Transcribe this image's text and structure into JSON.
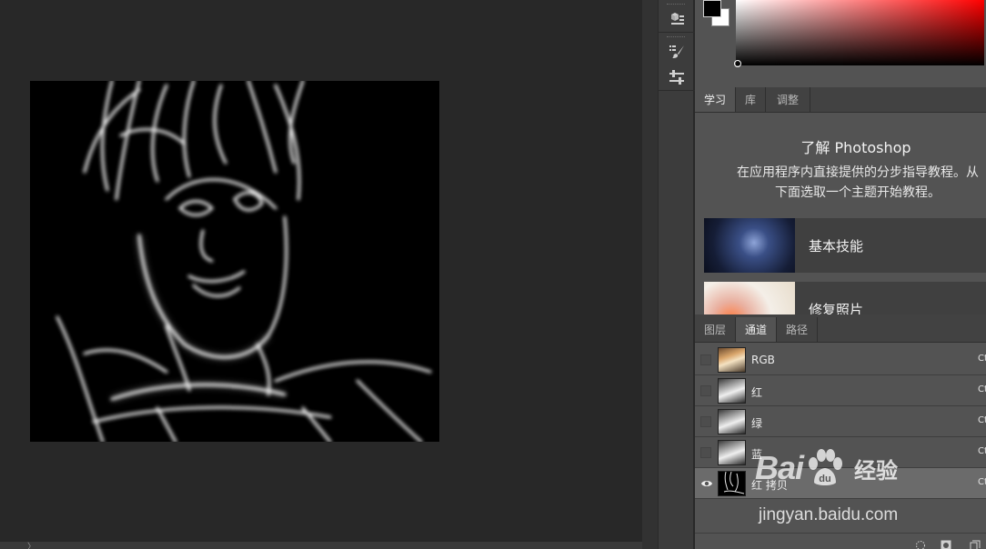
{
  "learn_panel": {
    "tabs": [
      {
        "label": "学习",
        "active": true
      },
      {
        "label": "库",
        "active": false
      },
      {
        "label": "调整",
        "active": false
      }
    ],
    "title": "了解 Photoshop",
    "description_line1": "在应用程序内直接提供的分步指导教程。从",
    "description_line2": "下面选取一个主题开始教程。",
    "cards": [
      {
        "label": "基本技能"
      },
      {
        "label": "修复照片"
      }
    ]
  },
  "channels_panel": {
    "tabs": [
      {
        "label": "图层",
        "active": false
      },
      {
        "label": "通道",
        "active": true
      },
      {
        "label": "路径",
        "active": false
      }
    ],
    "channels": [
      {
        "name": "RGB",
        "shortcut": "Ct",
        "visible": false,
        "selected": false
      },
      {
        "name": "红",
        "shortcut": "Ct",
        "visible": false,
        "selected": false
      },
      {
        "name": "绿",
        "shortcut": "Ct",
        "visible": false,
        "selected": false
      },
      {
        "name": "蓝",
        "shortcut": "Ct",
        "visible": false,
        "selected": false
      },
      {
        "name": "红 拷贝",
        "shortcut": "Ct",
        "visible": true,
        "selected": true
      }
    ]
  },
  "colors": {
    "foreground": "#000000",
    "background": "#ffffff",
    "picker_hue": "#ff0000"
  },
  "watermark": {
    "brand_left": "Bai",
    "brand_right": "du",
    "product": "经验",
    "url": "jingyan.baidu.com"
  }
}
